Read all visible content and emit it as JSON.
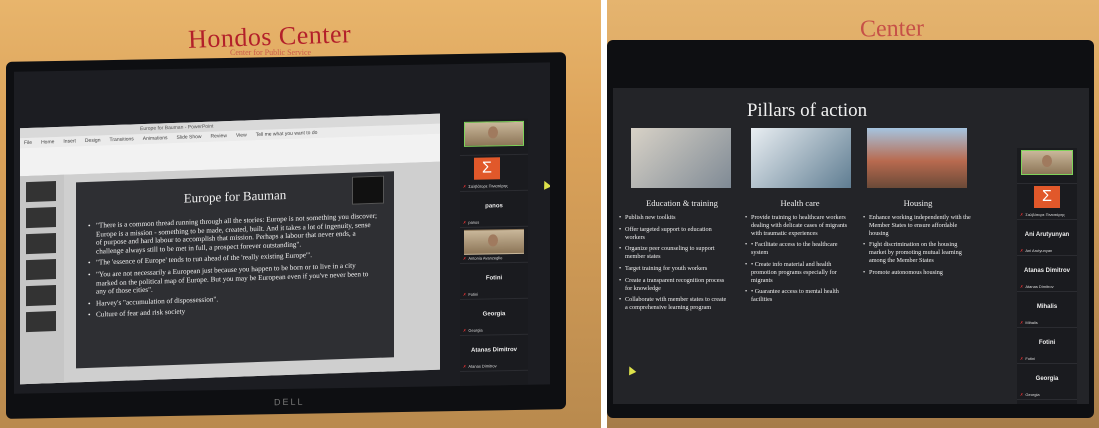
{
  "photos": {
    "left": {
      "sign_text": "Hondos Center",
      "sign_subtext": "Center for Public Service",
      "monitor_brand": "DELL",
      "ppt": {
        "window_title": "Europe for Bauman - PowerPoint",
        "tabs": [
          "File",
          "Home",
          "Insert",
          "Design",
          "Transitions",
          "Animations",
          "Slide Show",
          "Review",
          "View",
          "Tell me what you want to do"
        ],
        "slide": {
          "title": "Europe for Bauman",
          "bullets": [
            "\"There is a common thread running through all the stories: Europe is not something you discover; Europe is a mission - something to be made, created, built. And it takes a lot of ingenuity, sense of purpose and hard labour to accomplish that mission. Perhaps a labour that never ends, a challenge always still to be met in full, a prospect forever outstanding\".",
            "\"The 'essence of Europe' tends to run ahead of the 'really existing Europe'\".",
            "\"You are not necessarily a European just because you happen to be born or to live in a city marked on the political map of Europe. But you may be European even if you've never been to any of those cities\".",
            "Harvey's \"accumulation of dispossession\".",
            "Culture of fear and risk society"
          ]
        }
      },
      "participants": [
        {
          "name": "",
          "tag": "",
          "type": "video"
        },
        {
          "name": "",
          "tag": "Σαλβάτορε Πινιατάρης",
          "type": "sigma"
        },
        {
          "name": "panos",
          "tag": "panos",
          "type": "text"
        },
        {
          "name": "",
          "tag": "Antonia Avanzeglio",
          "type": "video"
        },
        {
          "name": "Fotini",
          "tag": "Fotini",
          "type": "text"
        },
        {
          "name": "Georgia",
          "tag": "Georgia",
          "type": "text"
        },
        {
          "name": "Atanas Dimitrov",
          "tag": "Atanas Dimitrov",
          "type": "text"
        }
      ]
    },
    "right": {
      "sign_text": "Center",
      "slide": {
        "title": "Pillars of action",
        "columns": [
          {
            "title": "Education & training",
            "items": [
              "Publish new toolkits",
              "Offer targeted support to education workers",
              "Organize peer counseling to support member states",
              "Target training for youth workers",
              "Create a transparent recognition process for knowledge",
              "Collaborate with member states to create a comprehensive learning program"
            ]
          },
          {
            "title": "Health care",
            "items": [
              "Provide training to healthcare workers dealing with delicate cases of migrants with traumatic experiences",
              "• Facilitate access to the healthcare system",
              "• Create info material and health promotion programs especially for migrants",
              "• Guarantee access to mental health facilities"
            ]
          },
          {
            "title": "Housing",
            "items": [
              "Enhance working independently with the Member States to ensure affordable housing",
              "Fight discrimination on the housing market by promoting mutual learning among the Member States",
              "Promote autonomous housing"
            ]
          }
        ]
      },
      "participants": [
        {
          "name": "",
          "tag": "",
          "type": "video"
        },
        {
          "name": "",
          "tag": "Σαλβάτορε Πινιατάρης",
          "type": "sigma"
        },
        {
          "name": "Ani Arutyunyan",
          "tag": "Ani Arutyunyan",
          "type": "text"
        },
        {
          "name": "Atanas Dimitrov",
          "tag": "Atanas Dimitrov",
          "type": "text"
        },
        {
          "name": "Mihalis",
          "tag": "Mihalis",
          "type": "text"
        },
        {
          "name": "Fotini",
          "tag": "Fotini",
          "type": "text"
        },
        {
          "name": "Georgia",
          "tag": "Georgia",
          "type": "text"
        }
      ]
    }
  },
  "colors": {
    "sign_red": "#b3202a",
    "sigma_orange": "#e1582a",
    "speaker_green": "#7fd35a",
    "mic_red": "#e33333"
  },
  "icons": {
    "mute": "microphone-muted-icon",
    "cursor": "mouse-cursor-icon"
  }
}
